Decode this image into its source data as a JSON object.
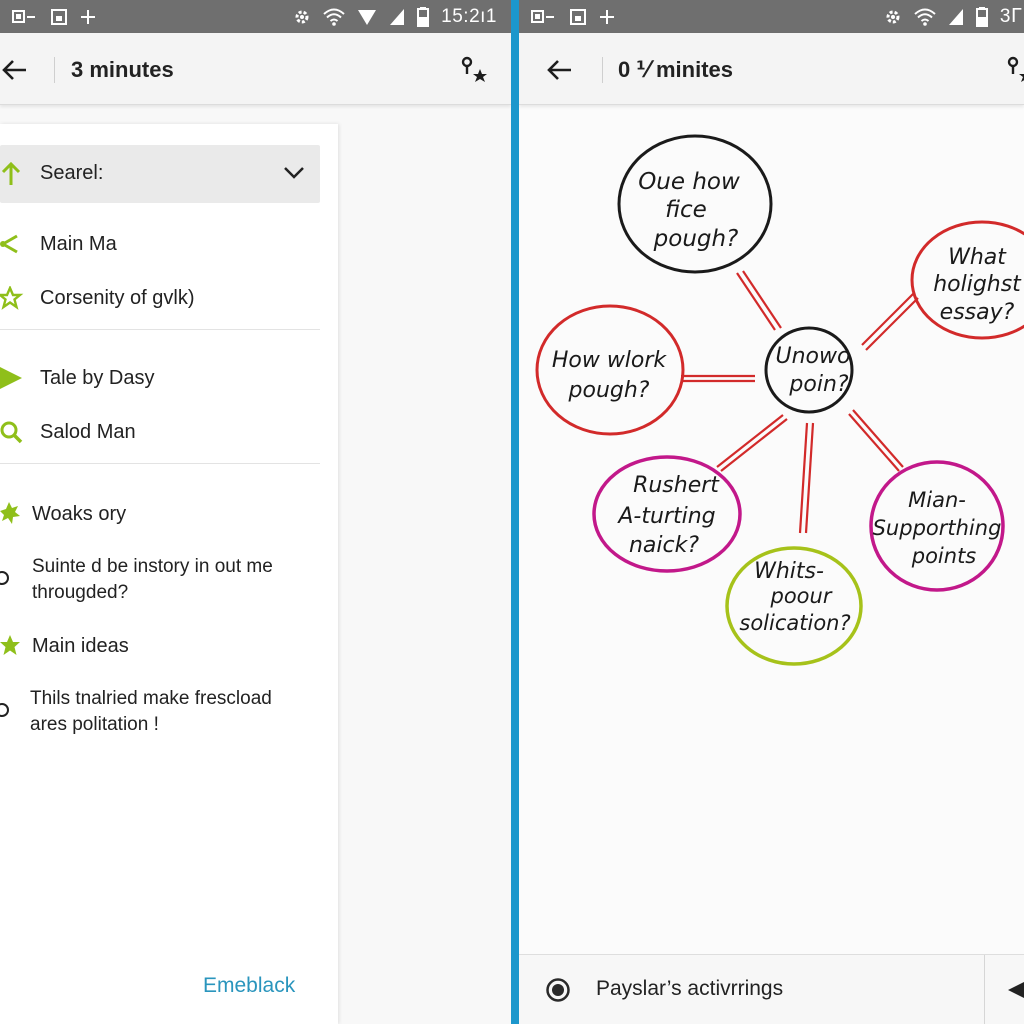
{
  "left": {
    "status": {
      "time": "15:2ı1"
    },
    "appbar": {
      "title": "3 minutes"
    },
    "search": {
      "label": "Searel:"
    },
    "menu": [
      {
        "label": "Main Ma"
      },
      {
        "label": "Corsenity of gvlk)"
      },
      {
        "label": "Tale by Dasy"
      },
      {
        "label": "Salod Man"
      }
    ],
    "notes": [
      {
        "label": "Woaks ory"
      },
      {
        "line1": "Suinte d be instory in out me",
        "line2": "througded?"
      },
      {
        "label": "Main ideas"
      },
      {
        "line1": "Thils tnalried make frescload",
        "line2": "ares politation !"
      }
    ],
    "footer_link": "Emeblack"
  },
  "right": {
    "status": {
      "time": "3ᒥ"
    },
    "appbar": {
      "title": "0 ⅟ minites"
    },
    "mindmap": {
      "center": {
        "lines": [
          "Unowo",
          "poin?"
        ],
        "color": "#1a1a1a"
      },
      "nodes": [
        {
          "lines": [
            "Oue how",
            "fice",
            "pough?"
          ],
          "color": "#1a1a1a"
        },
        {
          "lines": [
            "What",
            "holighst",
            "essay?"
          ],
          "color": "#d22a2a"
        },
        {
          "lines": [
            "How wlork",
            "pough?"
          ],
          "color": "#d22a2a"
        },
        {
          "lines": [
            "Rushert",
            "A-turting",
            "naick?"
          ],
          "color": "#c2188a"
        },
        {
          "lines": [
            "Whits-",
            "poour",
            "solication?"
          ],
          "color": "#a6c21a"
        },
        {
          "lines": [
            "Mian-",
            "Supporthing",
            "points"
          ],
          "color": "#c2188a"
        }
      ],
      "link_color": "#d22a2a"
    },
    "bottom": {
      "label": "Payslar’s activrrings"
    }
  },
  "colors": {
    "accent_green": "#8fbf1a",
    "link_blue": "#2a95bd",
    "divider_blue": "#1c97cc"
  }
}
